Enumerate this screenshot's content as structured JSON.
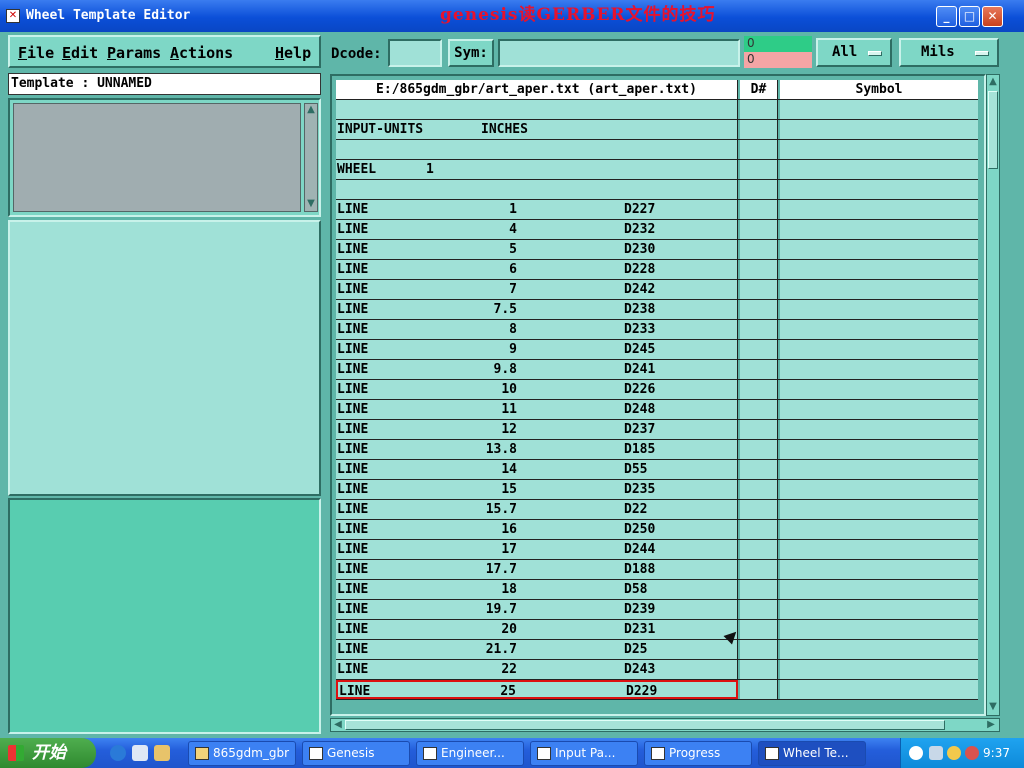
{
  "window": {
    "title": "Wheel Template Editor",
    "overlay_caption": "genesis读GERBER文件的技巧",
    "minimize": "_",
    "maximize": "□",
    "close": "✕"
  },
  "menubar": {
    "file": "File",
    "edit": "Edit",
    "params": "Params",
    "actions": "Actions",
    "help": "Help"
  },
  "template_label": "Template : UNNAMED",
  "toolbar": {
    "dcode_label": "Dcode:",
    "dcode_value": "",
    "sym_label": "Sym:",
    "sym_value": "",
    "indicator_top": "0",
    "indicator_bottom": "0",
    "filter_dropdown": "All",
    "units_dropdown": "Mils"
  },
  "colors": {
    "indicator_top": "#2ecc87",
    "indicator_bottom": "#f4a5a5",
    "selection_border": "#dd1111"
  },
  "table": {
    "headers": [
      "E:/865gdm_gbr/art_aper.txt (art_aper.txt)",
      "D#",
      "Symbol"
    ],
    "rows": [
      {
        "type": "",
        "size": "",
        "dcode": ""
      },
      {
        "type": "INPUT-UNITS",
        "size": "INCHES",
        "dcode": ""
      },
      {
        "type": "",
        "size": "",
        "dcode": ""
      },
      {
        "type": "WHEEL",
        "size": "1",
        "dcode": ""
      },
      {
        "type": "",
        "size": "",
        "dcode": ""
      },
      {
        "type": "LINE",
        "size": "1",
        "dcode": "D227"
      },
      {
        "type": "LINE",
        "size": "4",
        "dcode": "D232"
      },
      {
        "type": "LINE",
        "size": "5",
        "dcode": "D230"
      },
      {
        "type": "LINE",
        "size": "6",
        "dcode": "D228"
      },
      {
        "type": "LINE",
        "size": "7",
        "dcode": "D242"
      },
      {
        "type": "LINE",
        "size": "7.5",
        "dcode": "D238"
      },
      {
        "type": "LINE",
        "size": "8",
        "dcode": "D233"
      },
      {
        "type": "LINE",
        "size": "9",
        "dcode": "D245"
      },
      {
        "type": "LINE",
        "size": "9.8",
        "dcode": "D241"
      },
      {
        "type": "LINE",
        "size": "10",
        "dcode": "D226"
      },
      {
        "type": "LINE",
        "size": "11",
        "dcode": "D248"
      },
      {
        "type": "LINE",
        "size": "12",
        "dcode": "D237"
      },
      {
        "type": "LINE",
        "size": "13.8",
        "dcode": "D185"
      },
      {
        "type": "LINE",
        "size": "14",
        "dcode": "D55"
      },
      {
        "type": "LINE",
        "size": "15",
        "dcode": "D235"
      },
      {
        "type": "LINE",
        "size": "15.7",
        "dcode": "D22"
      },
      {
        "type": "LINE",
        "size": "16",
        "dcode": "D250"
      },
      {
        "type": "LINE",
        "size": "17",
        "dcode": "D244"
      },
      {
        "type": "LINE",
        "size": "17.7",
        "dcode": "D188"
      },
      {
        "type": "LINE",
        "size": "18",
        "dcode": "D58"
      },
      {
        "type": "LINE",
        "size": "19.7",
        "dcode": "D239"
      },
      {
        "type": "LINE",
        "size": "20",
        "dcode": "D231"
      },
      {
        "type": "LINE",
        "size": "21.7",
        "dcode": "D25"
      },
      {
        "type": "LINE",
        "size": "22",
        "dcode": "D243"
      },
      {
        "type": "LINE",
        "size": "25",
        "dcode": "D229"
      }
    ],
    "selected_row": 29
  },
  "taskbar": {
    "start_label": "开始",
    "tasks": [
      "865gdm_gbr",
      "Genesis",
      "Engineer...",
      "Input Pa...",
      "Progress",
      "Wheel Te..."
    ],
    "active_task": 5,
    "clock": "9:37"
  }
}
